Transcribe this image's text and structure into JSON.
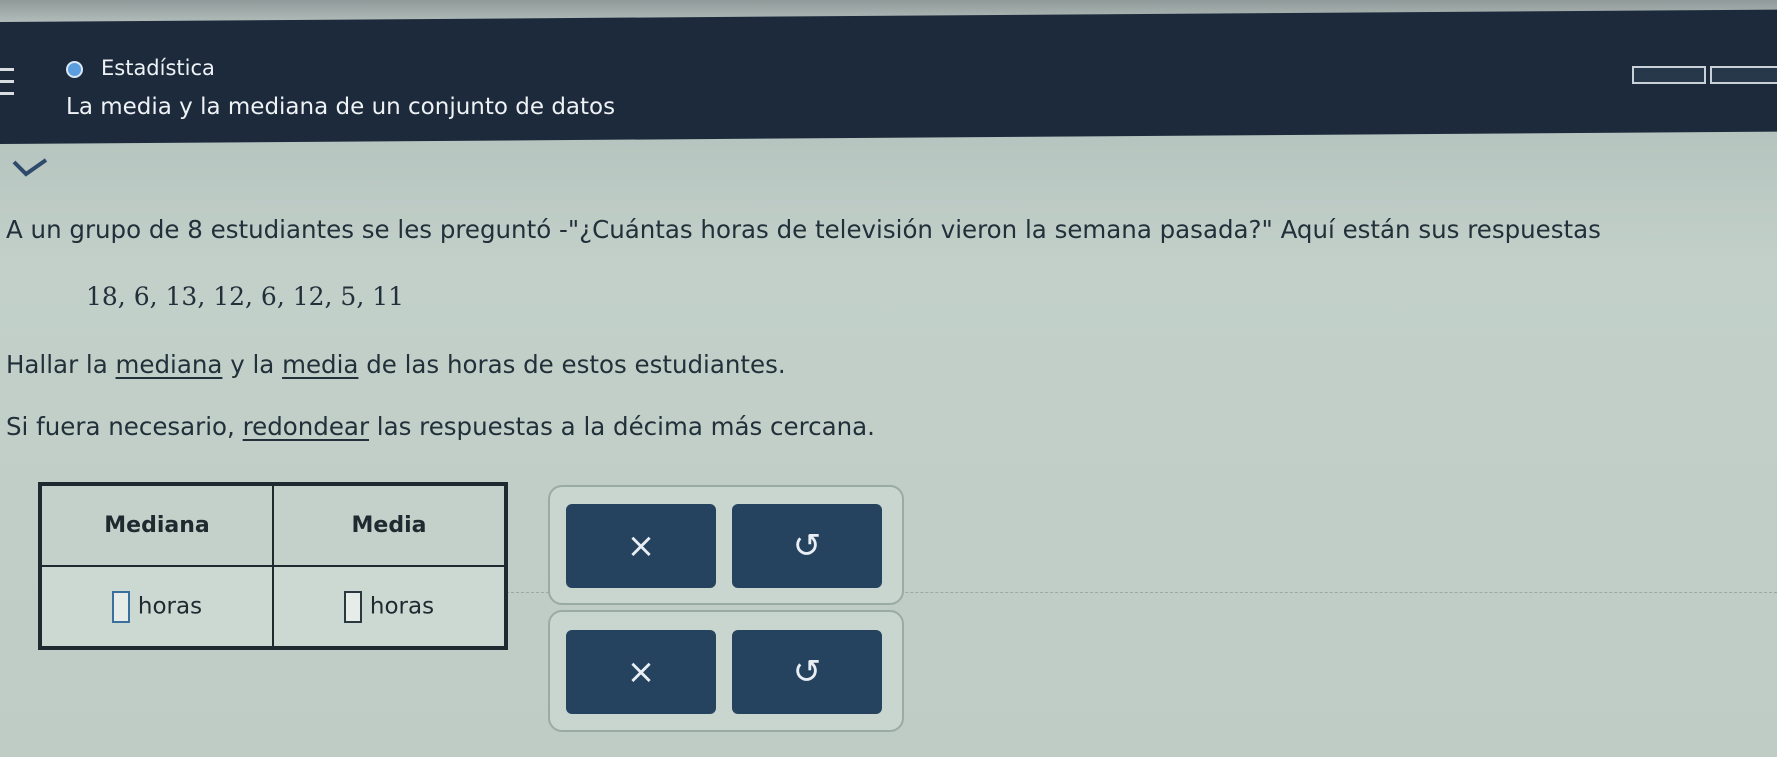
{
  "header": {
    "topic": "Estadística",
    "lesson_title": "La media y la mediana de un conjunto de datos"
  },
  "problem": {
    "intro": "A un grupo de 8 estudiantes se les preguntó -\"¿Cuántas horas de televisión vieron la semana pasada?\" Aquí están sus respuestas",
    "data_values": "18, 6, 13, 12, 6, 12, 5, 11",
    "instruction": {
      "part1": "Hallar la ",
      "mediana": "mediana",
      "part2": " y la ",
      "media": "media",
      "part3": " de las horas de estos estudiantes."
    },
    "rounding": {
      "part1": "Si fuera necesario, ",
      "redondear": "redondear",
      "part2": " las respuestas a la décima más cercana."
    }
  },
  "table": {
    "headers": [
      "Mediana",
      "Media"
    ],
    "unit_mediana": "horas",
    "unit_media": "horas"
  },
  "buttons": {
    "clear_symbol": "×",
    "undo_symbol": "↺"
  },
  "icons": {
    "menu": "menu-icon",
    "topic": "circle-icon",
    "check": "chevron-down-icon",
    "clear": "close-icon",
    "undo": "undo-icon"
  },
  "colors": {
    "header_bg": "#1c2a3b",
    "topic_dot": "#5a9ee0",
    "button_bg": "#25435e"
  }
}
